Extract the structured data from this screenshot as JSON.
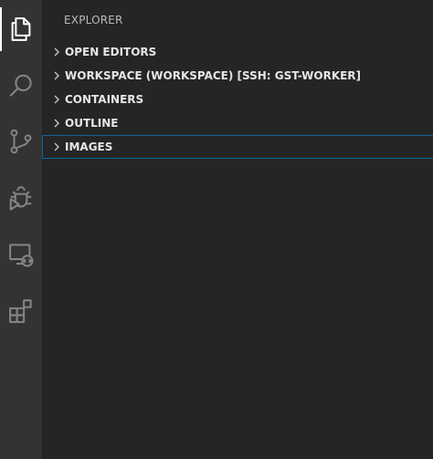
{
  "sidebar": {
    "title": "EXPLORER",
    "sections": [
      {
        "label": "OPEN EDITORS"
      },
      {
        "label": "WORKSPACE (WORKSPACE) [SSH: GST-WORKER]"
      },
      {
        "label": "CONTAINERS"
      },
      {
        "label": "OUTLINE"
      },
      {
        "label": "IMAGES"
      }
    ]
  },
  "activity_bar": {
    "items": [
      {
        "icon": "files-icon"
      },
      {
        "icon": "search-icon"
      },
      {
        "icon": "source-control-icon"
      },
      {
        "icon": "debug-icon"
      },
      {
        "icon": "remote-explorer-icon"
      },
      {
        "icon": "extensions-icon"
      }
    ]
  },
  "colors": {
    "activity_bar_bg": "#333333",
    "sidebar_bg": "#252526",
    "focus_border": "#0e639c",
    "icon_active": "#ffffff",
    "icon_inactive": "#858585"
  }
}
